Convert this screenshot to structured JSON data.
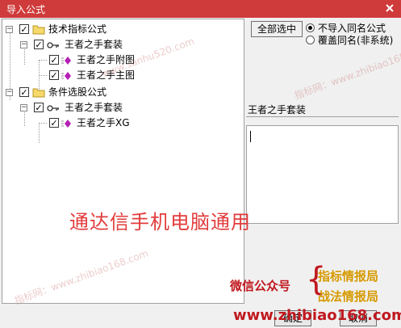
{
  "window": {
    "title": "导入公式",
    "close_icon": "close-icon"
  },
  "tree": {
    "nodes": [
      {
        "label": "技术指标公式",
        "icon": "folder-icon",
        "checked": true,
        "expanded": true
      },
      {
        "label": "王者之手套装",
        "icon": "key-icon",
        "checked": true,
        "expanded": true
      },
      {
        "label": "王者之手附图",
        "icon": "formula-icon",
        "checked": true
      },
      {
        "label": "王者之手主图",
        "icon": "formula-icon",
        "checked": true
      },
      {
        "label": "条件选股公式",
        "icon": "folder-icon",
        "checked": true,
        "expanded": true
      },
      {
        "label": "王者之手套装",
        "icon": "key-icon",
        "checked": true,
        "expanded": true
      },
      {
        "label": "王者之手XG",
        "icon": "formula-icon",
        "checked": true
      }
    ]
  },
  "right": {
    "select_all_label": "全部选中",
    "options": [
      {
        "label": "不导入同名公式",
        "selected": true
      },
      {
        "label": "覆盖同名(非系统)",
        "selected": false
      }
    ],
    "info_label": "王者之手套装",
    "description": ""
  },
  "watermarks": {
    "main": "通达信手机电脑通用",
    "site_text": "www.sanhu520.com",
    "wm_text": "指标网：www.zhibiao168.com",
    "wechat_label": "微信公众号",
    "tag1": "指标情报局",
    "tag2": "战法情报局",
    "site": "www.zhibiao168.com"
  },
  "buttons": {
    "ok": "确定",
    "cancel": "取消"
  },
  "colors": {
    "title_bar": "#cf3a3a",
    "watermark_red": "#e23c3c",
    "accent_gold": "#d69a00"
  }
}
